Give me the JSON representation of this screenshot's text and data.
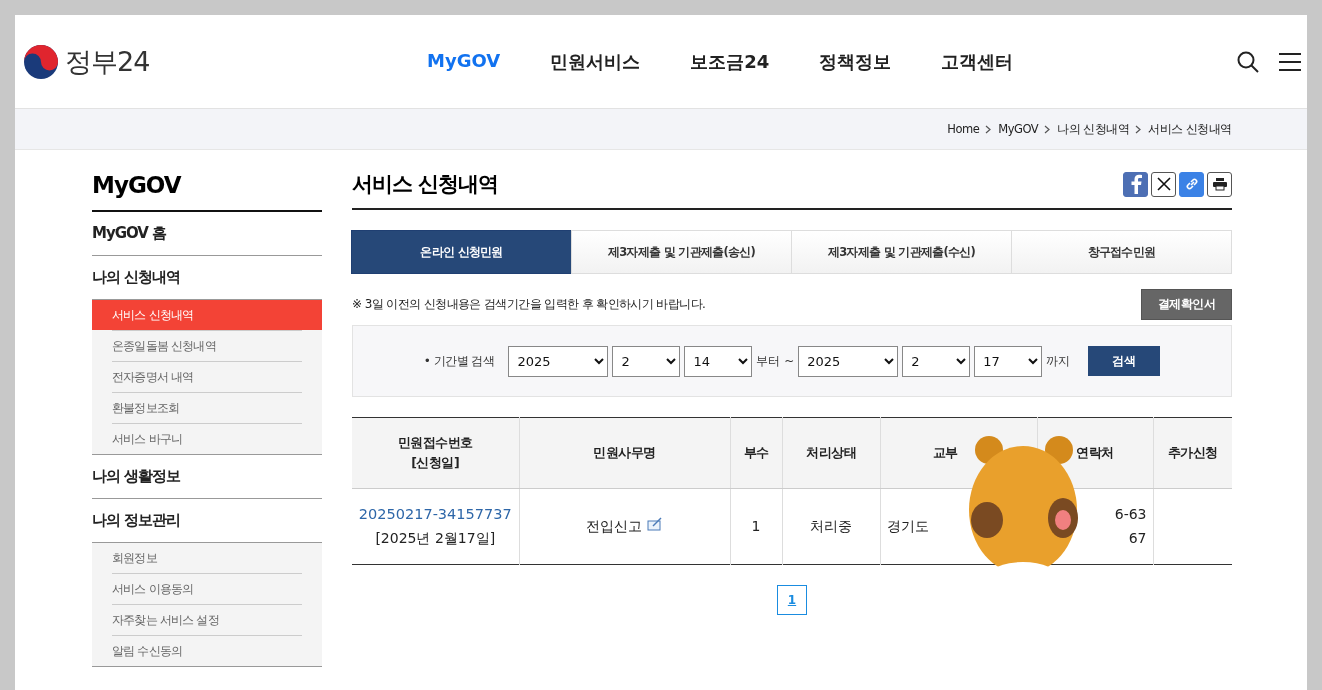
{
  "header": {
    "logo_text": "정부24",
    "nav": [
      {
        "label": "MyGOV",
        "selected": true
      },
      {
        "label": "민원서비스",
        "selected": false
      },
      {
        "label": "보조금24",
        "selected": false
      },
      {
        "label": "정책정보",
        "selected": false
      },
      {
        "label": "고객센터",
        "selected": false
      }
    ]
  },
  "breadcrumb": [
    "Home",
    "MyGOV",
    "나의 신청내역",
    "서비스 신청내역"
  ],
  "sidebar": {
    "title": "MyGOV",
    "groups": [
      {
        "label": "MyGOV 홈"
      },
      {
        "label": "나의 신청내역",
        "children": [
          {
            "label": "서비스 신청내역",
            "selected": true
          },
          {
            "label": "온종일돌봄 신청내역",
            "selected": false
          },
          {
            "label": "전자증명서 내역",
            "selected": false
          },
          {
            "label": "환불정보조회",
            "selected": false
          },
          {
            "label": "서비스 바구니",
            "selected": false
          }
        ]
      },
      {
        "label": "나의 생활정보"
      },
      {
        "label": "나의 정보관리",
        "children": [
          {
            "label": "회원정보",
            "selected": false
          },
          {
            "label": "서비스 이용동의",
            "selected": false
          },
          {
            "label": "자주찾는 서비스 설정",
            "selected": false
          },
          {
            "label": "알림 수신동의",
            "selected": false
          }
        ]
      }
    ]
  },
  "page_title": "서비스 신청내역",
  "tabs": [
    {
      "label": "온라인 신청민원",
      "selected": true
    },
    {
      "label": "제3자제출 및 기관제출(송신)",
      "selected": false
    },
    {
      "label": "제3자제출 및 기관제출(수신)",
      "selected": false
    },
    {
      "label": "창구접수민원",
      "selected": false
    }
  ],
  "notice": "※ 3일 이전의 신청내용은 검색기간을 입력한 후 확인하시기 바랍니다.",
  "receipt_button": "결제확인서",
  "search": {
    "label": "• 기간별 검색",
    "from": [
      "2025",
      "2",
      "14"
    ],
    "from_suffix": "부터 ~",
    "to": [
      "2025",
      "2",
      "17"
    ],
    "to_suffix": "까지",
    "button": "검색"
  },
  "table": {
    "columns": [
      [
        "민원접수번호",
        "[신청일]"
      ],
      [
        "민원사무명"
      ],
      [
        "부수"
      ],
      [
        "처리상태"
      ],
      [
        "교부"
      ],
      [
        "연락처"
      ],
      [
        "추가신청"
      ]
    ],
    "rows": [
      {
        "receipt_no": "20250217-34157737",
        "date": "[2025년 2월17일]",
        "name": "전입신고",
        "count": "1",
        "status": "처리중",
        "agency": "경기도",
        "contact": [
          "6-63",
          "67"
        ]
      }
    ]
  },
  "pagination": [
    {
      "label": "1",
      "selected": true
    }
  ],
  "sticker": {
    "kind": "picture"
  }
}
